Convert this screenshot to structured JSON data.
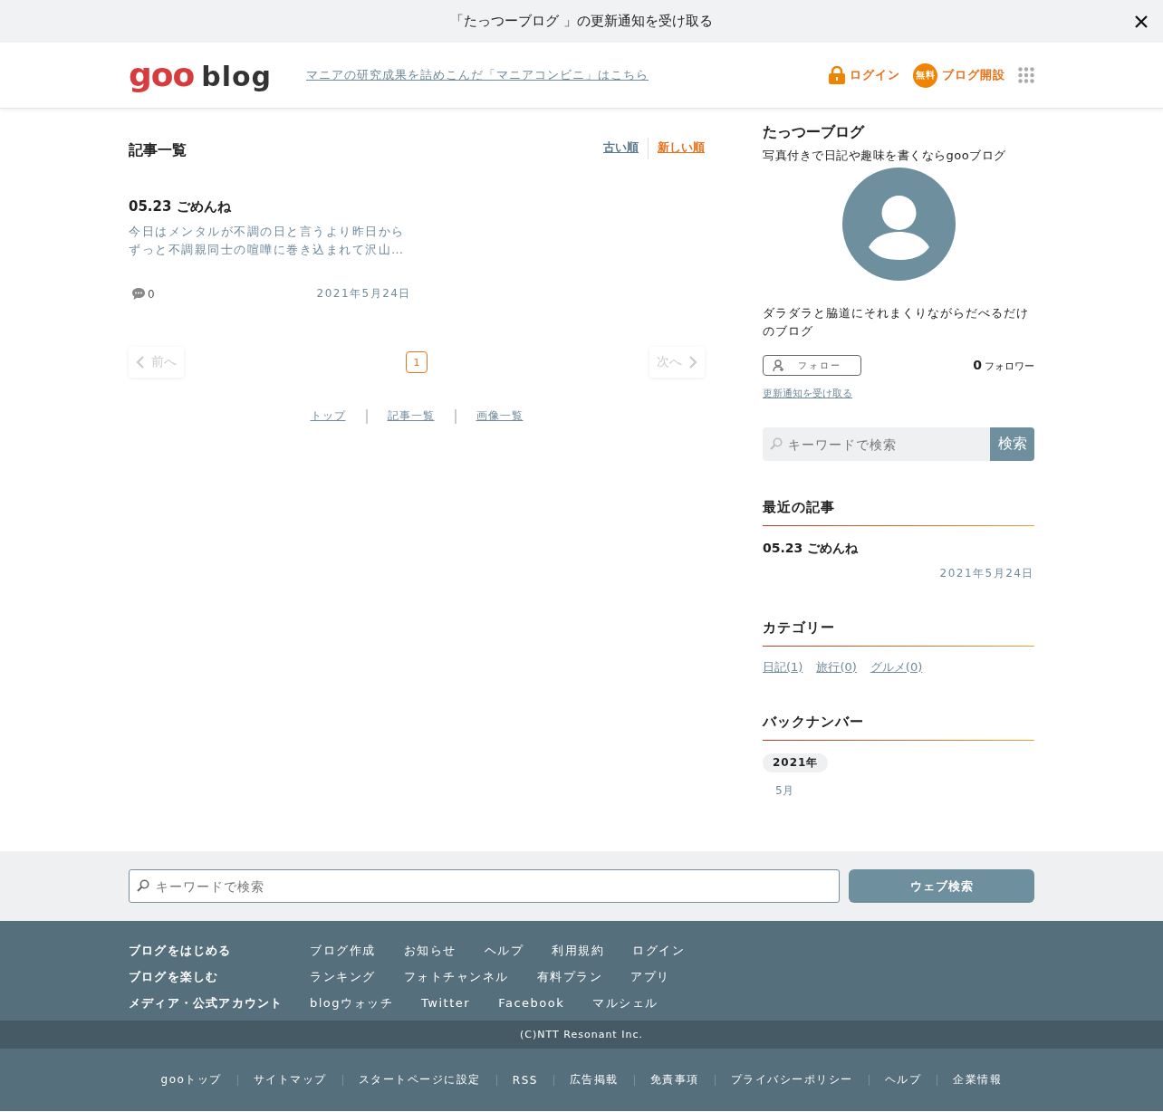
{
  "banner": {
    "text": "「たっつーブログ 」の更新通知を受け取る"
  },
  "header": {
    "logo": {
      "goo": "goo",
      "blog": "blog"
    },
    "promo_link": "マニアの研究成果を詰めこんだ「マニアコンビニ」はこちら",
    "login": "ログイン",
    "create_blog": {
      "label": "ブログ開設",
      "badge": "無料"
    }
  },
  "main": {
    "title": "記事一覧",
    "sort": [
      {
        "label": "古い順",
        "selected": false
      },
      {
        "label": "新しい順",
        "selected": true
      }
    ],
    "articles": [
      {
        "title": "05.23 ごめんね",
        "excerpt_lines": [
          "今日はメンタルが不調の日と言うより昨日から",
          "ずっと不調親同士の喧嘩に巻き込まれて沢山…"
        ],
        "comments": "0",
        "date": "2021年5月24日"
      }
    ],
    "pagination": {
      "prev": {
        "label": "前へ",
        "disabled": true
      },
      "pages": [
        {
          "label": "1",
          "selected": true
        }
      ],
      "next": {
        "label": "次へ",
        "disabled": true
      }
    },
    "links": [
      "トップ",
      "記事一覧",
      "画像一覧"
    ]
  },
  "sidebar": {
    "blog_title": "たっつーブログ",
    "tagline": "写真付きで日記や趣味を書くならgooブログ",
    "description": "ダラダラと脇道にそれまくりながらだべるだけのブログ",
    "follow_button": "フォロー",
    "follower_count": "0",
    "follower_label": "フォロワー",
    "notify_link": "更新通知を受け取る",
    "search": {
      "placeholder": "キーワードで検索",
      "button": "検索"
    },
    "recent": {
      "title": "最近の記事",
      "items": [
        {
          "title": "05.23 ごめんね",
          "date": "2021年5月24日"
        }
      ]
    },
    "categories": {
      "title": "カテゴリー",
      "items": [
        "日記(1)",
        "旅行(0)",
        "グルメ(0)"
      ]
    },
    "backnumber": {
      "title": "バックナンバー",
      "years": [
        {
          "label": "2021年",
          "months": [
            "5月"
          ]
        }
      ]
    }
  },
  "bottom_search": {
    "placeholder": "キーワードで検索",
    "button": "ウェブ検索"
  },
  "footer": {
    "rows": [
      {
        "heading": "ブログをはじめる",
        "links": [
          "ブログ作成",
          "お知らせ",
          "ヘルプ",
          "利用規約",
          "ログイン"
        ]
      },
      {
        "heading": "ブログを楽しむ",
        "links": [
          "ランキング",
          "フォトチャンネル",
          "有料プラン",
          "アプリ"
        ]
      },
      {
        "heading": "メディア・公式アカウント",
        "links": [
          "blogウォッチ",
          "Twitter",
          "Facebook",
          "マルシェル"
        ]
      }
    ],
    "copyright": "(C)NTT Resonant Inc.",
    "bottom_links": [
      "gooトップ",
      "サイトマップ",
      "スタートページに設定",
      "RSS",
      "広告掲載",
      "免責事項",
      "プライバシーポリシー",
      "ヘルプ",
      "企業情報"
    ]
  }
}
